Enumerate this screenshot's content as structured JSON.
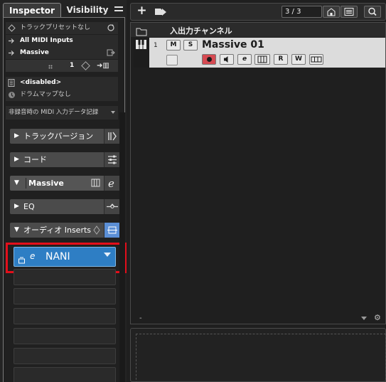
{
  "inspector": {
    "tab_inspector": "Inspector",
    "tab_visibility": "Visibility",
    "preset_label": "トラックプリセットなし",
    "midi_input": "All MIDI Inputs",
    "midi_output": "Massive",
    "channel_number": "1",
    "program_label": "<disabled>",
    "drum_map_label": "ドラムマップなし",
    "record_mode_label": "非録音時の MIDI 入力データ記録",
    "sections": [
      {
        "label": "トラックバージョン"
      },
      {
        "label": "コード"
      },
      {
        "label": "Massive"
      },
      {
        "label": "EQ"
      },
      {
        "label": "オーディオ Inserts"
      }
    ],
    "insert_slot_name": "NANI"
  },
  "tracklist": {
    "counter": "3 / 3",
    "header_title": "入出力チャンネル",
    "track": {
      "number": "1",
      "name": "Massive 01",
      "mute": "M",
      "solo": "S",
      "read": "R",
      "write": "W"
    },
    "footer_dash": "-"
  },
  "colors": {
    "highlight_box": "#e30f1b",
    "insert_slot_bg": "#2e7ec4",
    "record_button": "#d64a52"
  }
}
